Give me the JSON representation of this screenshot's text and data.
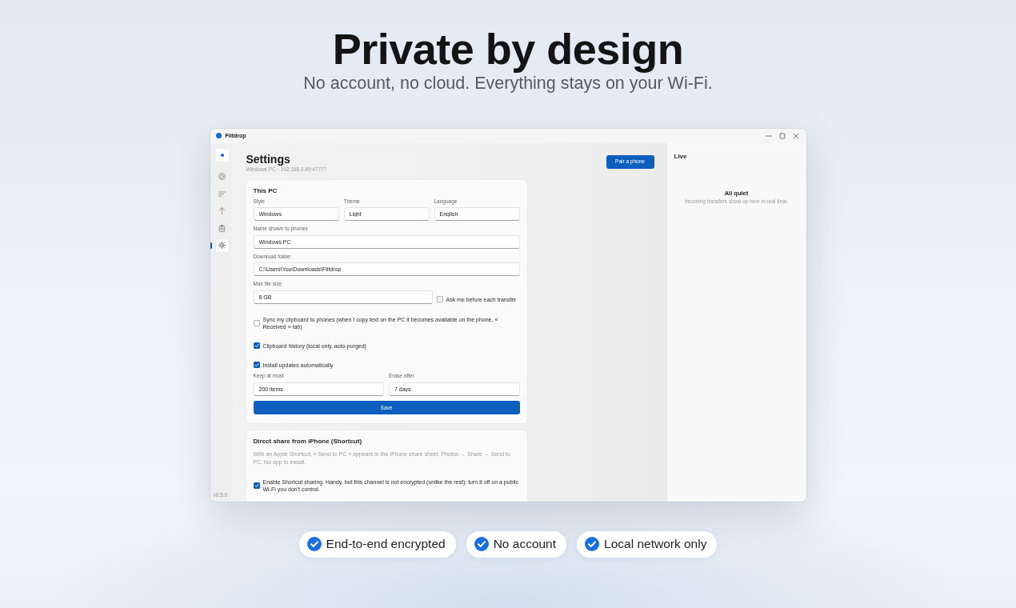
{
  "hero": {
    "title": "Private by design",
    "subtitle": "No account, no cloud. Everything stays on your Wi-Fi."
  },
  "window": {
    "title": "Flitdrop"
  },
  "sidebar": {
    "items": [
      {
        "kind": "devices",
        "selected": false
      },
      {
        "kind": "list",
        "selected": false
      },
      {
        "kind": "upload",
        "selected": false
      },
      {
        "kind": "clipboard",
        "selected": false
      },
      {
        "kind": "settings",
        "selected": true
      }
    ],
    "version": "v0.5.0"
  },
  "header": {
    "title": "Settings",
    "subtitle": "Windows PC · 192.168.0.49:47777",
    "button": "Pair a phone"
  },
  "cards": [
    {
      "title": "This PC",
      "rows": [
        {
          "kind": "fields",
          "fields": [
            {
              "label": "Style",
              "value": "Windows"
            },
            {
              "label": "Theme",
              "value": "Light"
            },
            {
              "label": "Language",
              "value": "English"
            }
          ]
        },
        {
          "kind": "fields",
          "fields": [
            {
              "label": "Name shown to phones",
              "value": "Windows PC"
            }
          ]
        },
        {
          "kind": "fields",
          "fields": [
            {
              "label": "Download folder",
              "value": "C:\\Users\\You\\Downloads\\Flitdrop"
            }
          ]
        },
        {
          "kind": "field_check",
          "field": {
            "label": "Max file size",
            "value": "8 GB"
          },
          "checkbox": {
            "label": "Ask me before each transfer",
            "checked": false
          }
        },
        {
          "kind": "checkbox",
          "label": "Sync my clipboard to phones (when I copy text on the PC it becomes available on the phone, « Received » tab)",
          "checked": false
        },
        {
          "kind": "checkbox",
          "label": "Clipboard history (local only, auto-purged)",
          "checked": true
        },
        {
          "kind": "checkbox",
          "label": "Install updates automatically",
          "checked": true
        },
        {
          "kind": "fields",
          "fields": [
            {
              "label": "Keep at most",
              "value": "200 items"
            },
            {
              "label": "Erase after",
              "value": "7 days"
            }
          ]
        },
        {
          "kind": "button",
          "label": "Save"
        }
      ]
    },
    {
      "title": "Direct share from iPhone (Shortcut)",
      "rows": [
        {
          "kind": "note",
          "text": "With an Apple Shortcut, « Send to PC » appears in the iPhone share sheet: Photos → Share → Send to PC. No app to install."
        },
        {
          "kind": "checkbox",
          "label": "Enable Shortcut sharing. Handy, but this channel is not encrypted (unlike the rest): turn it off on a public Wi-Fi you don't control.",
          "checked": true
        }
      ]
    }
  ],
  "live": {
    "title": "Live",
    "empty_title": "All quiet",
    "empty_text": "Incoming transfers show up here in real time."
  },
  "badges": [
    "End-to-end encrypted",
    "No account",
    "Local network only"
  ]
}
